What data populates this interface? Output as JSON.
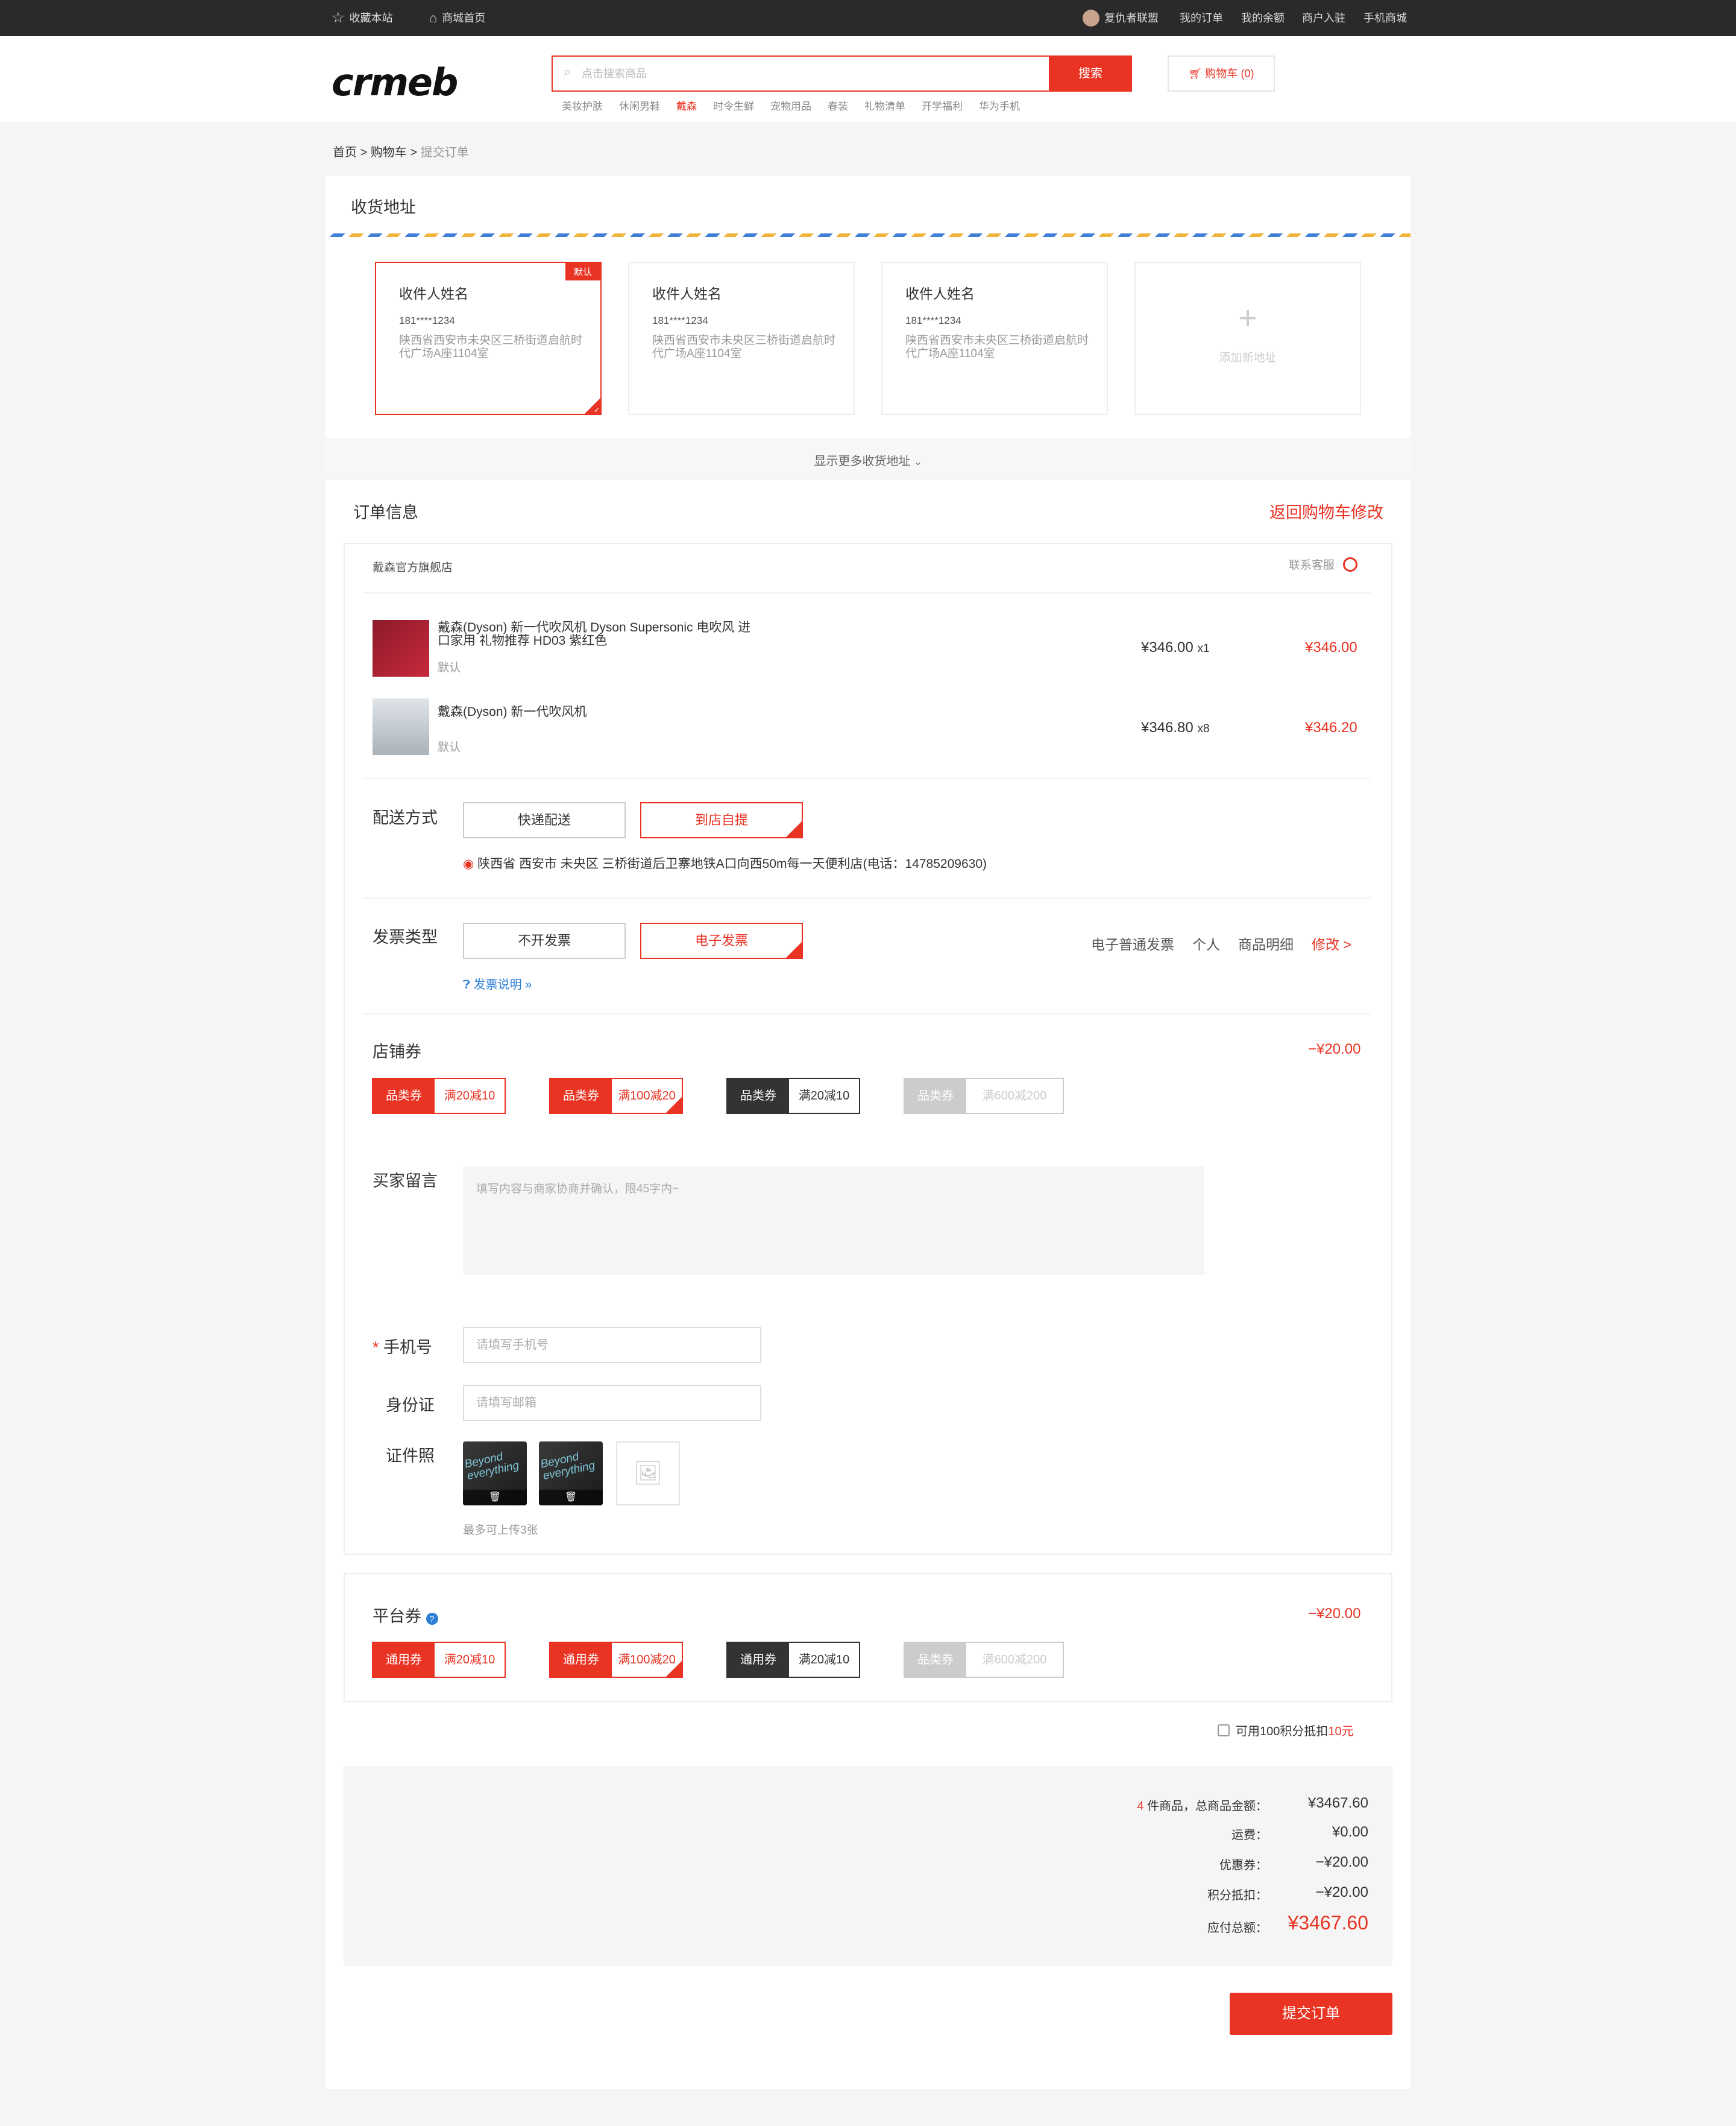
{
  "topbar": {
    "left": [
      "收藏本站",
      "商城首页"
    ],
    "user": "复仇者联盟",
    "right": [
      "我的订单",
      "我的余额",
      "商户入驻",
      "手机商城"
    ]
  },
  "header": {
    "logo": "crmeb",
    "search_placeholder": "点击搜索商品",
    "search_button": "搜索",
    "cart": "购物车",
    "cart_count": "(0)",
    "hot": [
      "美妆护肤",
      "休闲男鞋",
      "戴森",
      "时令生鲜",
      "宠物用品",
      "春装",
      "礼物清单",
      "开学福利",
      "华为手机"
    ],
    "hot_active_index": 2
  },
  "breadcrumb": {
    "home": "首页",
    "sep": ">",
    "cart": "购物车",
    "current": "提交订单"
  },
  "address": {
    "title": "收货地址",
    "default_tag": "默认",
    "cards": [
      {
        "name": "收件人姓名",
        "phone": "181****1234",
        "addr": "陕西省西安市未央区三桥街道启航时代广场A座1104室",
        "selected": true
      },
      {
        "name": "收件人姓名",
        "phone": "181****1234",
        "addr": "陕西省西安市未央区三桥街道启航时代广场A座1104室",
        "selected": false
      },
      {
        "name": "收件人姓名",
        "phone": "181****1234",
        "addr": "陕西省西安市未央区三桥街道启航时代广场A座1104室",
        "selected": false
      }
    ],
    "add_new": "添加新地址",
    "more": "显示更多收货地址"
  },
  "order": {
    "title": "订单信息",
    "back": "返回购物车修改",
    "store": "戴森官方旗舰店",
    "service": "联系客服",
    "items": [
      {
        "name": "戴森(Dyson) 新一代吹风机 Dyson Supersonic 电吹风 进口家用 礼物推荐 HD03 紫红色",
        "spec": "默认",
        "price": "¥346.00",
        "qty": "x1",
        "total": "¥346.00"
      },
      {
        "name": "戴森(Dyson) 新一代吹风机",
        "spec": "默认",
        "price": "¥346.80",
        "qty": "x8",
        "total": "¥346.20"
      }
    ]
  },
  "delivery": {
    "label": "配送方式",
    "options": [
      "快递配送",
      "到店自提"
    ],
    "selected": 1,
    "address": "陕西省 西安市 未央区 三桥街道后卫寨地铁A口向西50m每一天便利店(电话：14785209630)"
  },
  "invoice": {
    "label": "发票类型",
    "options": [
      "不开发票",
      "电子发票"
    ],
    "selected": 1,
    "desc": "发票说明 »",
    "info": [
      "电子普通发票",
      "个人",
      "商品明细"
    ],
    "edit": "修改 >"
  },
  "shop_coupon": {
    "label": "店铺券",
    "amount": "−¥20.00",
    "coupons": [
      {
        "type": "品类券",
        "text": "满20减10",
        "style": "red"
      },
      {
        "type": "品类券",
        "text": "满100减20",
        "style": "red",
        "checked": true
      },
      {
        "type": "品类券",
        "text": "满20减10",
        "style": "dark"
      },
      {
        "type": "品类券",
        "text": "满600减200",
        "style": "grey"
      }
    ]
  },
  "remark": {
    "label": "买家留言",
    "placeholder": "填写内容与商家协商并确认，限45字内~"
  },
  "form": {
    "phone_label": "手机号",
    "phone_required": "*",
    "phone_placeholder": "请填写手机号",
    "id_label": "身份证",
    "id_placeholder": "请填写邮箱",
    "photo_label": "证件照",
    "photo_text": "Beyond everything",
    "photo_hint": "最多可上传3张"
  },
  "platform_coupon": {
    "label": "平台券",
    "amount": "−¥20.00",
    "coupons": [
      {
        "type": "通用券",
        "text": "满20减10",
        "style": "red"
      },
      {
        "type": "通用券",
        "text": "满100减20",
        "style": "red",
        "checked": true
      },
      {
        "type": "通用券",
        "text": "满20减10",
        "style": "dark"
      },
      {
        "type": "品类券",
        "text": "满600减200",
        "style": "grey"
      }
    ]
  },
  "points": {
    "text": "可用100积分抵扣",
    "value": "10元"
  },
  "summary": {
    "count": "4",
    "count_text": "件商品，总商品金额：",
    "goods_total": "¥3467.60",
    "freight_label": "运费：",
    "freight": "¥0.00",
    "coupon_label": "优惠券：",
    "coupon": "−¥20.00",
    "points_label": "积分抵扣：",
    "points": "−¥20.00",
    "pay_label": "应付总额：",
    "pay": "¥3467.60"
  },
  "submit": "提交订单",
  "colors": {
    "accent": "#e93323",
    "topbar": "#2a2a2a"
  }
}
